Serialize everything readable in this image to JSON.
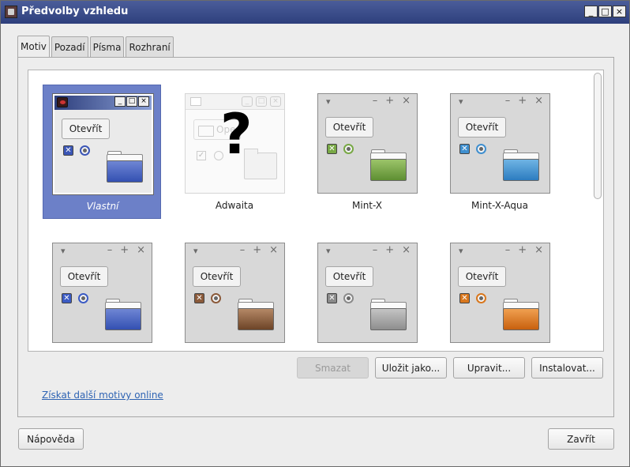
{
  "window": {
    "title": "Předvolby vzhledu",
    "controls": [
      "_",
      "□",
      "×"
    ]
  },
  "tabs": [
    {
      "label": "Motiv",
      "active": true
    },
    {
      "label": "Pozadí",
      "active": false
    },
    {
      "label": "Písma",
      "active": false
    },
    {
      "label": "Rozhraní",
      "active": false
    }
  ],
  "themes": [
    {
      "name": "Vlastní",
      "selected": true,
      "button_label": "Otevřít",
      "accent": "#3b56b6"
    },
    {
      "name": "Adwaita",
      "selected": false,
      "button_label": "Open",
      "missing_mark": "?"
    },
    {
      "name": "Mint-X",
      "selected": false,
      "button_label": "Otevřít",
      "accent": "#78a845"
    },
    {
      "name": "Mint-X-Aqua",
      "selected": false,
      "button_label": "Otevřít",
      "accent": "#3f8fcf"
    },
    {
      "name": "",
      "selected": false,
      "button_label": "Otevřít",
      "accent": "#3b5bc4"
    },
    {
      "name": "",
      "selected": false,
      "button_label": "Otevřít",
      "accent": "#8b5a3a"
    },
    {
      "name": "",
      "selected": false,
      "button_label": "Otevřít",
      "accent": "#8a8a8a"
    },
    {
      "name": "",
      "selected": false,
      "button_label": "Otevřít",
      "accent": "#d9771d"
    }
  ],
  "preview_glyphs": {
    "menu": "▾",
    "minimize": "–",
    "maximize": "+",
    "close": "×",
    "check": "✕",
    "adw_check": "✓"
  },
  "actions": {
    "delete_label": "Smazat",
    "save_as_label": "Uložit jako...",
    "edit_label": "Upravit...",
    "install_label": "Instalovat..."
  },
  "online_link": "Získat další motivy online",
  "footer": {
    "help_label": "Nápověda",
    "close_label": "Zavřít"
  },
  "colors": {
    "titlebar": "#2e3f7c",
    "selection": "#6c80c8",
    "link": "#2e63b3"
  }
}
